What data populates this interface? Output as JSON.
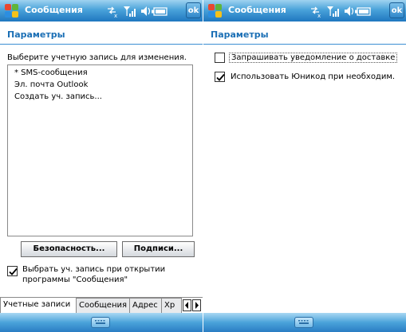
{
  "colors": {
    "titlebar": "#2b84c9",
    "header_text": "#1b6fb5",
    "accent": "#3b8ed2"
  },
  "left": {
    "title": "Сообщения",
    "ok_label": "ok",
    "section_header": "Параметры",
    "prompt": "Выберите учетную запись для изменения.",
    "accounts": [
      "* SMS-сообщения",
      "Эл. почта Outlook",
      "Создать уч. запись..."
    ],
    "security_button": "Безопасность...",
    "signatures_button": "Подписи...",
    "select_account_checkbox": {
      "checked": true,
      "label_line1": "Выбрать уч. запись при открытии",
      "label_line2": "программы \"Сообщения\""
    },
    "tabs": [
      "Учетные записи",
      "Сообщения",
      "Адрес",
      "Хр"
    ],
    "icons": [
      "start-windows-icon",
      "data-connection-icon",
      "signal-icon",
      "speaker-icon",
      "battery-icon",
      "scroll-left-icon",
      "scroll-right-icon",
      "keyboard-icon"
    ]
  },
  "right": {
    "title": "Сообщения",
    "ok_label": "ok",
    "section_header": "Параметры",
    "options": [
      {
        "label": "Запрашивать уведомление о доставке",
        "checked": false
      },
      {
        "label": "Использовать Юникод при необходим.",
        "checked": true
      }
    ],
    "icons": [
      "start-windows-icon",
      "data-connection-icon",
      "signal-icon",
      "speaker-icon",
      "battery-icon",
      "keyboard-icon"
    ]
  }
}
